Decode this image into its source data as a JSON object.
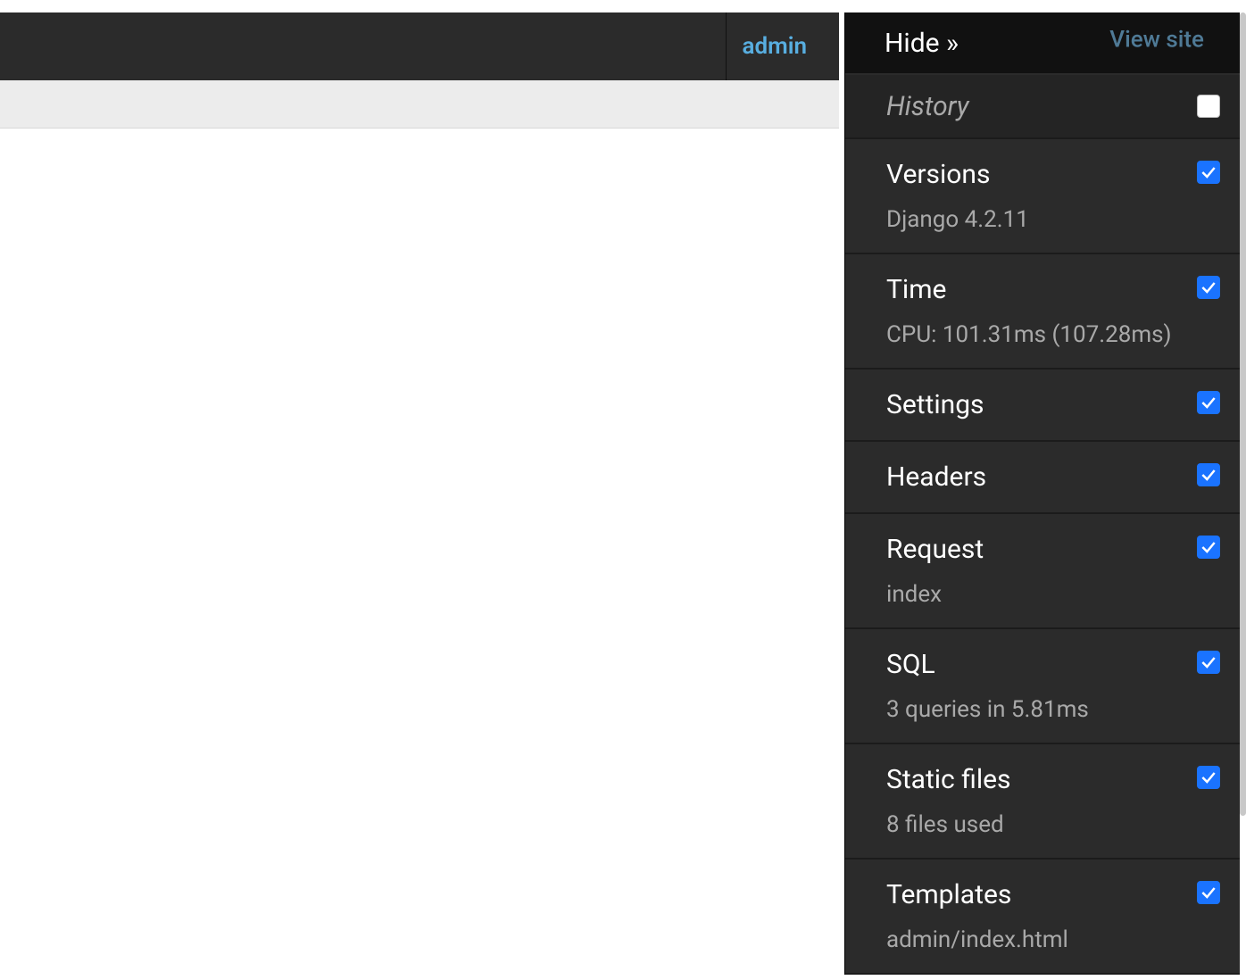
{
  "header": {
    "user": "admin"
  },
  "debug": {
    "hide_label": "Hide »",
    "view_site_label": "View site",
    "history_label": "History",
    "panels": [
      {
        "title": "Versions",
        "subtitle": "Django 4.2.11",
        "checked": true
      },
      {
        "title": "Time",
        "subtitle": "CPU: 101.31ms (107.28ms)",
        "checked": true
      },
      {
        "title": "Settings",
        "subtitle": "",
        "checked": true
      },
      {
        "title": "Headers",
        "subtitle": "",
        "checked": true
      },
      {
        "title": "Request",
        "subtitle": "index",
        "checked": true
      },
      {
        "title": "SQL",
        "subtitle": "3 queries in 5.81ms",
        "checked": true
      },
      {
        "title": "Static files",
        "subtitle": "8 files used",
        "checked": true
      },
      {
        "title": "Templates",
        "subtitle": "admin/index.html",
        "checked": true
      }
    ]
  }
}
